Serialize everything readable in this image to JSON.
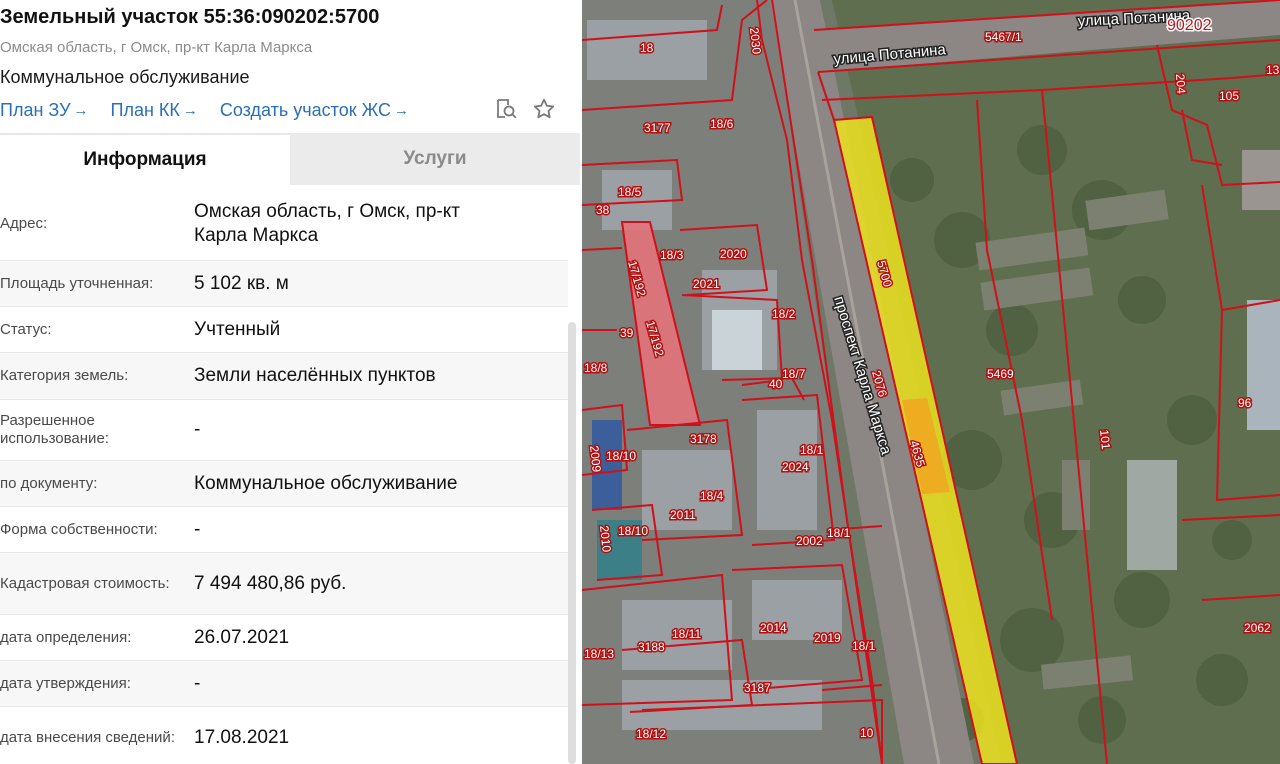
{
  "header": {
    "title": "Земельный участок 55:36:090202:5700",
    "address": "Омская область, г Омск, пр-кт Карла Маркса",
    "usage": "Коммунальное обслуживание"
  },
  "links": [
    {
      "label": "План ЗУ",
      "arrow": "→"
    },
    {
      "label": "План КК",
      "arrow": "→"
    },
    {
      "label": "Создать участок ЖС",
      "arrow": "→"
    }
  ],
  "icons": {
    "search": "search-doc-icon",
    "favorite": "star-icon"
  },
  "tabs": [
    {
      "label": "Информация",
      "active": true
    },
    {
      "label": "Услуги",
      "active": false
    }
  ],
  "info": [
    {
      "label": "Адрес:",
      "value": "Омская область, г Омск, пр-кт Карла Маркса"
    },
    {
      "label": "Площадь уточненная:",
      "value": "5 102 кв. м"
    },
    {
      "label": "Статус:",
      "value": "Учтенный"
    },
    {
      "label": "Категория земель:",
      "value": "Земли населённых пунктов"
    },
    {
      "label": "Разрешенное использование:",
      "value": "-"
    },
    {
      "label": "по документу:",
      "value": "Коммунальное обслуживание"
    },
    {
      "label": "Форма собственности:",
      "value": "-"
    },
    {
      "label": "Кадастровая стоимость:",
      "value": "7 494 480,86 руб."
    },
    {
      "label": "дата определения:",
      "value": "26.07.2021"
    },
    {
      "label": "дата утверждения:",
      "value": "-"
    },
    {
      "label": "дата внесения сведений:",
      "value": "17.08.2021"
    }
  ],
  "map": {
    "streets": {
      "main": "проспект Карла Маркса",
      "top": "улица Потанина",
      "top2": "улица Потанина"
    },
    "quarter": "90202",
    "parcel_selected": "5700",
    "parcel_adjacent": "4635",
    "labels": {
      "l2030": "2030",
      "l18": "18",
      "l5467": "5467/1",
      "l13": "13",
      "l204": "204",
      "l105": "105",
      "l3177": "3177",
      "l18_6": "18/6",
      "l18_5": "18/5",
      "l38": "38",
      "l18_3": "18/3",
      "l2020": "2020",
      "l2021": "2021",
      "l17192a": "17/192",
      "l17192b": "17/192",
      "l39": "39",
      "l18_2": "18/2",
      "l18_8": "18/8",
      "l40": "40",
      "l18_7": "18/7",
      "l2076": "2076",
      "l5469": "5469",
      "l96": "96",
      "l3178": "3178",
      "l18_10a": "18/10",
      "l2009": "2009",
      "l18_1a": "18/1",
      "l2024": "2024",
      "l18_4": "18/4",
      "l2011": "2011",
      "l101": "101",
      "l18_10b": "18/10",
      "l2010": "2010",
      "l18_1b": "18/1",
      "l2002": "2002",
      "l2062": "2062",
      "l18_13": "18/13",
      "l3188": "3188",
      "l18_11": "18/11",
      "l2014": "2014",
      "l2019": "2019",
      "l18_1c": "18/1",
      "l3187": "3187",
      "l18_12": "18/12",
      "l10": "10"
    }
  },
  "colors": {
    "link": "#2a6fb5",
    "parcel_fill": "#f2e51c",
    "parcel_adjacent_fill": "#f0a820",
    "boundary": "#d0101a",
    "pink_parcel": "#e8727a"
  }
}
